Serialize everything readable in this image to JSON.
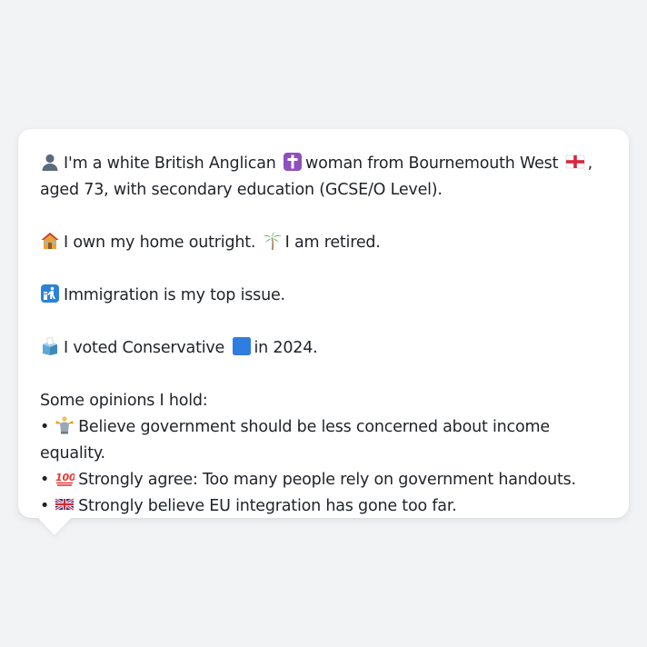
{
  "message": {
    "intro": {
      "before": "I'm a white British Anglican",
      "middle": "woman from Bournemouth West",
      "after": ", aged 73, with secondary education (GCSE/O Level).",
      "icon_person": "bust-in-silhouette-icon",
      "icon_religion": "latin-cross-icon",
      "icon_region": "england-flag-icon"
    },
    "home": {
      "housing": "I own my home outright.",
      "work": "I am retired.",
      "icon_housing": "house-icon",
      "icon_work": "palm-tree-icon"
    },
    "issue": {
      "text": "Immigration is my top issue.",
      "icon": "passport-control-icon"
    },
    "vote": {
      "before": "I voted Conservative",
      "after": "in 2024.",
      "icon_ballot": "ballot-box-icon",
      "icon_party": "blue-square-icon",
      "party_color": "#2f7de1"
    },
    "opinions": {
      "heading": "Some opinions I hold:",
      "bullet": "•",
      "items": [
        {
          "icon": "scales-figure-icon",
          "text": "Believe government should be less concerned about income equality."
        },
        {
          "icon": "hundred-points-icon",
          "text": "Strongly agree: Too many people rely on government handouts."
        },
        {
          "icon": "uk-flag-icon",
          "text": "Strongly believe EU integration has gone too far."
        }
      ]
    }
  }
}
